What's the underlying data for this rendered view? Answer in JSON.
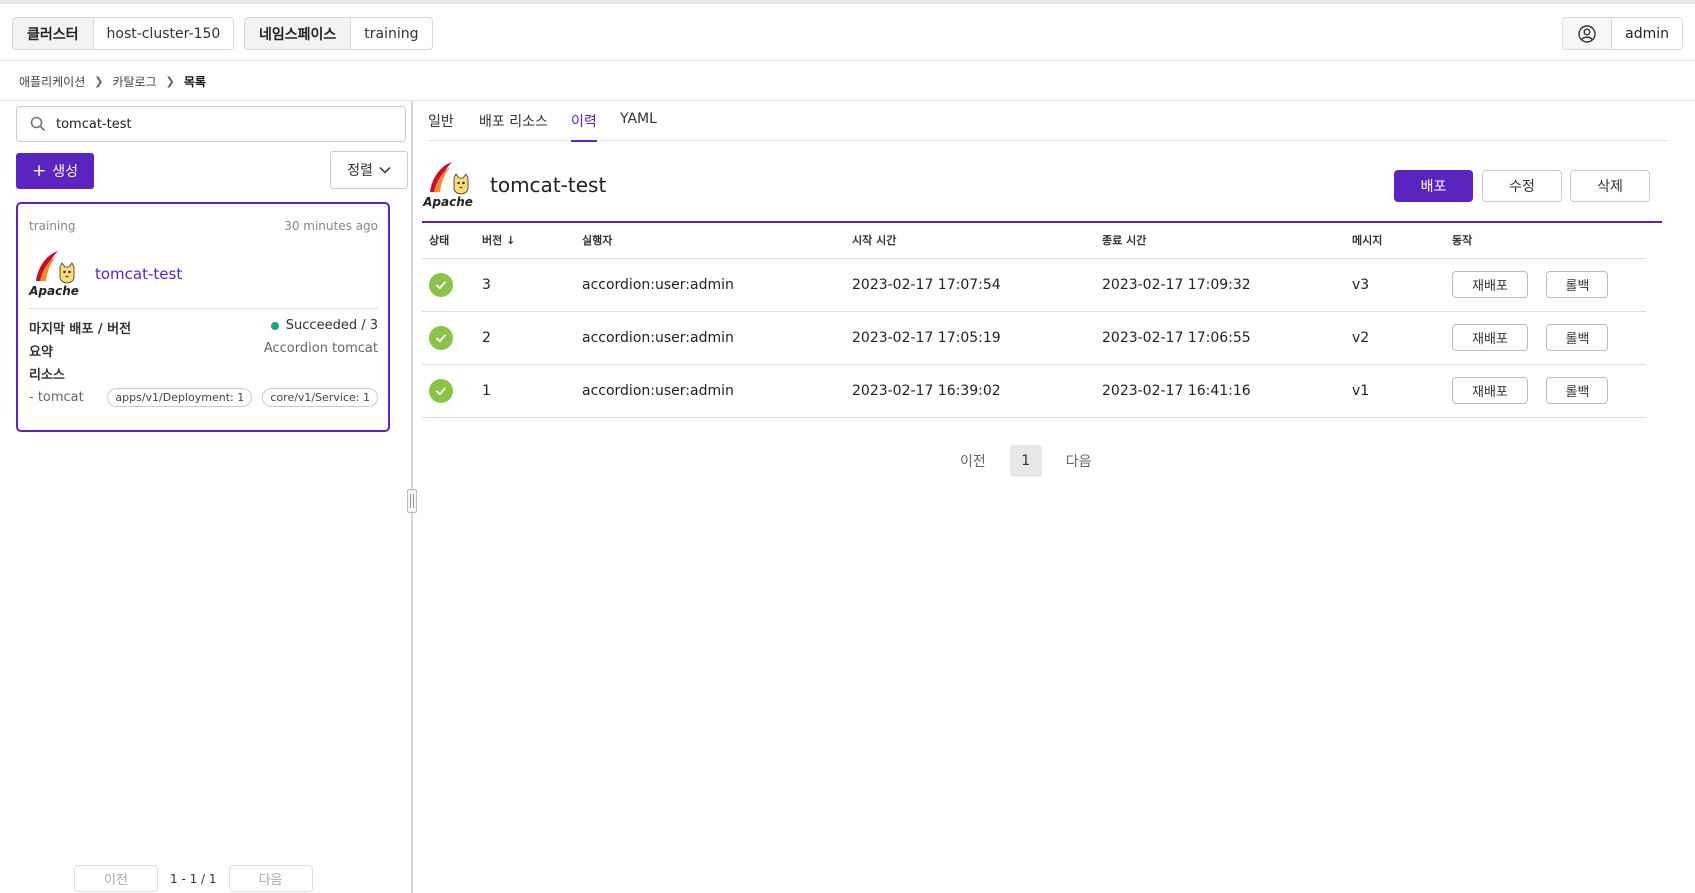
{
  "topbar": {
    "cluster_label": "클러스터",
    "cluster_value": "host-cluster-150",
    "namespace_label": "네임스페이스",
    "namespace_value": "training",
    "user_name": "admin"
  },
  "breadcrumb": [
    "애플리케이션",
    "카탈로그",
    "목록"
  ],
  "left": {
    "search_value": "tomcat-test",
    "create_label": "생성",
    "sort_label": "정렬",
    "card": {
      "namespace": "training",
      "time_ago": "30 minutes ago",
      "logo_text": "Apache",
      "title": "tomcat-test",
      "last_deploy_label": "마지막 배포 / 버전",
      "last_deploy_value": "Succeeded / 3",
      "summary_label": "요약",
      "summary_value": "Accordion tomcat",
      "resources_label": "리소스",
      "resource_name": "- tomcat",
      "tags": [
        "apps/v1/Deployment: 1",
        "core/v1/Service: 1"
      ]
    },
    "pager": {
      "prev": "이전",
      "info": "1 - 1 / 1",
      "next": "다음"
    }
  },
  "tabs": [
    "일반",
    "배포 리소스",
    "이력",
    "YAML"
  ],
  "active_tab": "이력",
  "detail": {
    "logo_text": "Apache",
    "title": "tomcat-test",
    "deploy_label": "배포",
    "edit_label": "수정",
    "delete_label": "삭제"
  },
  "history": {
    "columns": [
      "상태",
      "버전",
      "실행자",
      "시작 시간",
      "종료 시간",
      "메시지",
      "동작"
    ],
    "rows": [
      {
        "version": "3",
        "executor": "accordion:user:admin",
        "start": "2023-02-17 17:07:54",
        "end": "2023-02-17 17:09:32",
        "message": "v3"
      },
      {
        "version": "2",
        "executor": "accordion:user:admin",
        "start": "2023-02-17 17:05:19",
        "end": "2023-02-17 17:06:55",
        "message": "v2"
      },
      {
        "version": "1",
        "executor": "accordion:user:admin",
        "start": "2023-02-17 16:39:02",
        "end": "2023-02-17 16:41:16",
        "message": "v1"
      }
    ],
    "redeploy_label": "재배포",
    "rollback_label": "롤백"
  },
  "pager": {
    "prev": "이전",
    "page": "1",
    "next": "다음"
  },
  "colors": {
    "accent": "#5b23bf",
    "success": "#8bc34a"
  }
}
